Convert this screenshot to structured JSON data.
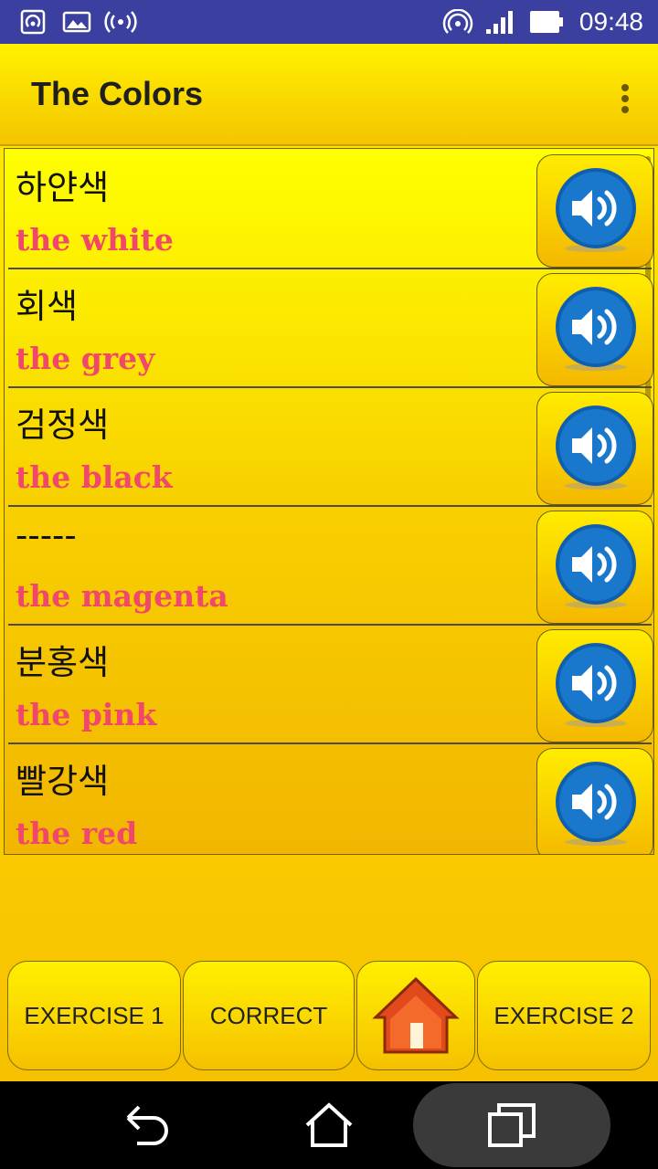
{
  "status_bar": {
    "time": "09:48",
    "left_icons": [
      "hotspot-icon",
      "image-icon",
      "broadcast-icon"
    ],
    "right_icons": [
      "wifi-icon",
      "signal-icon",
      "battery-icon"
    ]
  },
  "app_bar": {
    "title": "The Colors",
    "menu_icon": "more-vert-icon"
  },
  "list": {
    "items": [
      {
        "korean": "하얀색",
        "english": "the white"
      },
      {
        "korean": "회색",
        "english": "the grey"
      },
      {
        "korean": "검정색",
        "english": "the black"
      },
      {
        "korean": "-----",
        "english": "the magenta"
      },
      {
        "korean": "분홍색",
        "english": "the pink"
      },
      {
        "korean": "빨강색",
        "english": "the red"
      }
    ],
    "sound_icon": "speaker-icon"
  },
  "bottom_buttons": {
    "exercise1": "EXERCISE 1",
    "correct": "CORRECT",
    "home_icon": "home-icon",
    "exercise2": "EXERCISE 2"
  },
  "nav_bar": {
    "icons": [
      "back-icon",
      "home-nav-icon",
      "recents-icon"
    ]
  },
  "colors": {
    "status_bar": "#3a3fa0",
    "app_background": "#ffd400",
    "english_text": "#f0476a",
    "sound_button": "#1a6fc0"
  }
}
